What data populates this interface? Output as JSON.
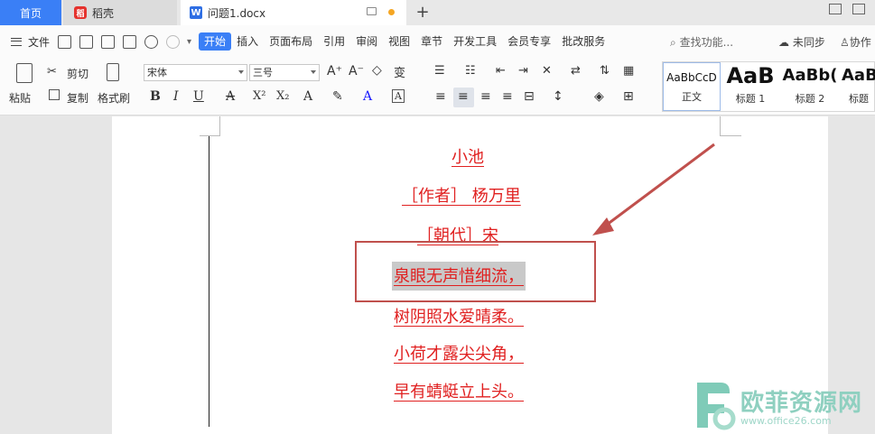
{
  "tabs": {
    "home": "首页",
    "daoke": "稻壳",
    "document": "问题1.docx",
    "new_tab": "+"
  },
  "menu": {
    "file": "文件",
    "tabs": [
      "开始",
      "插入",
      "页面布局",
      "引用",
      "审阅",
      "视图",
      "章节",
      "开发工具",
      "会员专享",
      "批改服务"
    ],
    "active_tab": "开始",
    "search": "查找功能...",
    "sync": "未同步",
    "collab": "协作"
  },
  "ribbon": {
    "paste": "粘贴",
    "cut": "剪切",
    "copy": "复制",
    "format_painter": "格式刷",
    "font_name": "宋体",
    "font_size": "三号",
    "bold": "B",
    "italic": "I",
    "underline": "U",
    "strike": "A",
    "superscript": "X²",
    "subscript": "X₂",
    "styles": [
      {
        "sample": "AaBbCcD",
        "name": "正文"
      },
      {
        "sample": "AaB",
        "name": "标题 1"
      },
      {
        "sample": "AaBb(",
        "name": "标题 2"
      },
      {
        "sample": "AaB",
        "name": "标题"
      }
    ]
  },
  "document": {
    "title": "小池",
    "author": "［作者］ 杨万里",
    "dynasty": "［朝代］宋",
    "lines": [
      "泉眼无声惜细流，",
      "树阴照水爱晴柔。",
      "小荷才露尖尖角，",
      "早有蜻蜓立上头。"
    ],
    "selected_line_index": 0
  },
  "colors": {
    "accent": "#3a7ff6",
    "poem_text": "#e02020",
    "callout": "#c0504d",
    "selection": "#c9c9c9"
  },
  "watermark": {
    "text": "欧菲资源网",
    "url": "www.office26.com"
  }
}
